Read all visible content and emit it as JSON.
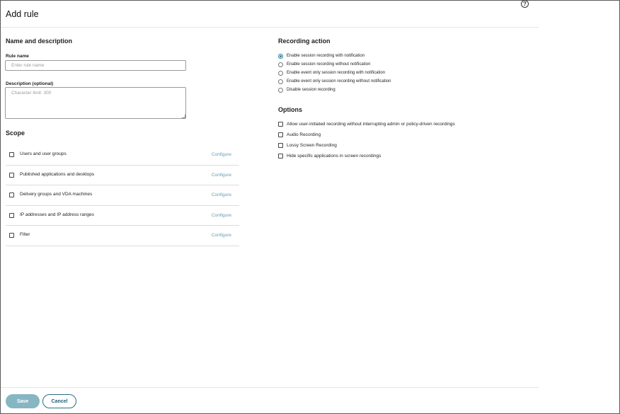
{
  "header": {
    "title": "Add rule"
  },
  "help": {
    "glyph": "?"
  },
  "name_description": {
    "title": "Name and description",
    "rule_name_label": "Rule name",
    "rule_name_value": "",
    "rule_name_placeholder": "Enter rule name",
    "description_label": "Description (optional)",
    "description_value": "",
    "description_placeholder": "Character limit: 300"
  },
  "scope": {
    "title": "Scope",
    "items": [
      {
        "label": "Users and user groups",
        "link": "Configure"
      },
      {
        "label": "Published applications and desktops",
        "link": "Configure"
      },
      {
        "label": "Delivery groups and VDA machines",
        "link": "Configure"
      },
      {
        "label": "IP addresses and IP address ranges",
        "link": "Configure"
      },
      {
        "label": "Filter",
        "link": "Configure"
      }
    ]
  },
  "recording_action": {
    "title": "Recording action",
    "selected_index": 0,
    "options": [
      {
        "label": "Enable session recording with notification"
      },
      {
        "label": "Enable session recording without notification"
      },
      {
        "label": "Enable event only session recording with notification"
      },
      {
        "label": "Enable event only session recording without notification"
      },
      {
        "label": "Disable session recording"
      }
    ]
  },
  "options": {
    "title": "Options",
    "items": [
      {
        "label": "Allow user-initiated recording without interrupting admin or policy-driven recordings"
      },
      {
        "label": "Audio Recording"
      },
      {
        "label": "Lossy Screen Recording"
      },
      {
        "label": "Hide specific applications in screen recordings"
      }
    ]
  },
  "footer": {
    "save_label": "Save",
    "cancel_label": "Cancel"
  },
  "colors": {
    "accent": "#2a7f94",
    "link": "#5fa0b2",
    "save_button": "#86b6c2"
  }
}
